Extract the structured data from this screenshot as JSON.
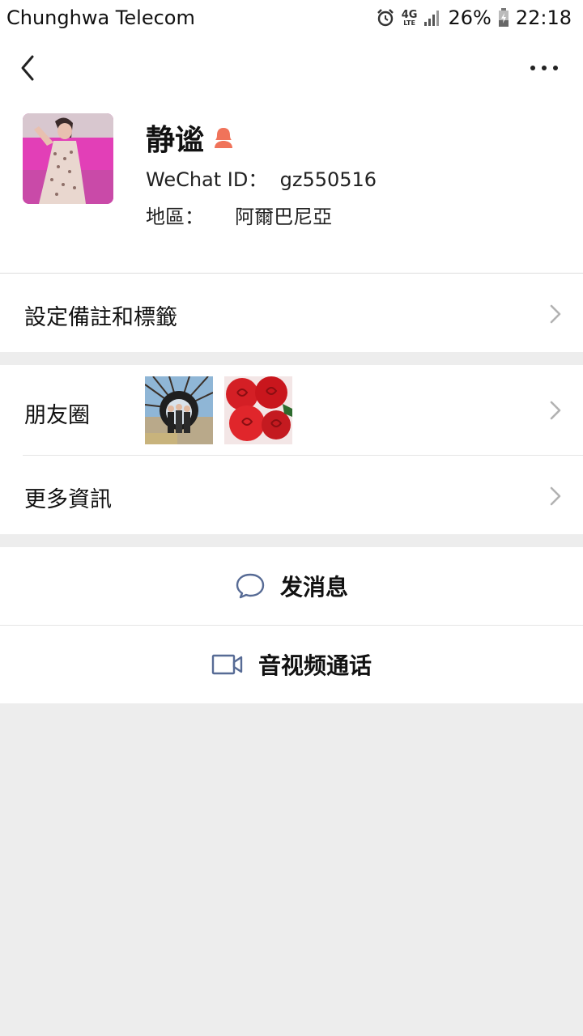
{
  "status_bar": {
    "carrier": "Chunghwa Telecom",
    "network": "4G",
    "network_sub": "LTE",
    "battery": "26%",
    "time": "22:18"
  },
  "nav": {
    "back_icon": "chevron-left-icon",
    "more_icon": "more-dots-icon"
  },
  "profile": {
    "name": "静谧",
    "wechat_id": "WeChat ID：  gz550516",
    "region": "地區：     阿爾巴尼亞",
    "gender_icon": "female-user-icon",
    "gender_color": "#f0735a"
  },
  "rows": {
    "remark_label": "設定備註和標籤",
    "moments_label": "朋友圈",
    "more_info_label": "更多資訊"
  },
  "actions": {
    "message_label": "发消息",
    "call_label": "音视频通话",
    "icon_color": "#576b95"
  }
}
